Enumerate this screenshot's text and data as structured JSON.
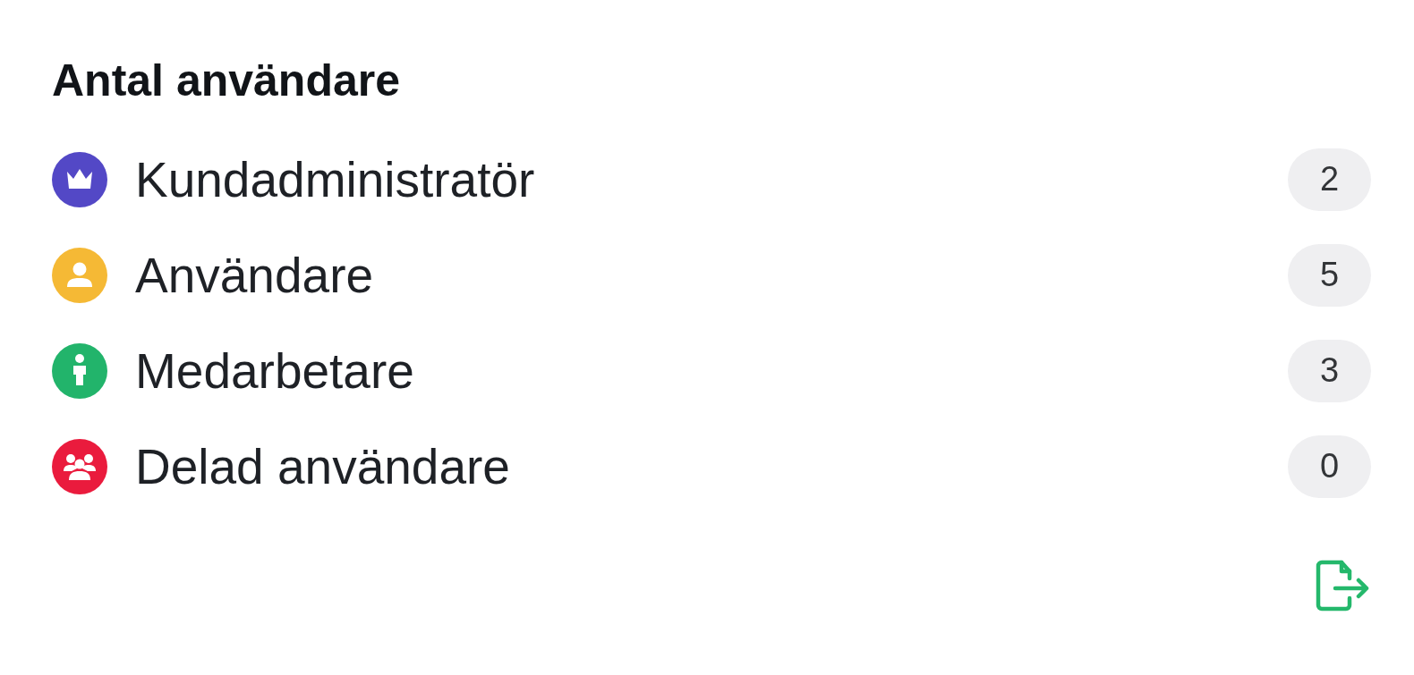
{
  "title": "Antal användare",
  "roles": [
    {
      "kind": "crown",
      "label": "Kundadministratör",
      "count": "2",
      "color": "#5348c6"
    },
    {
      "kind": "person",
      "label": "Användare",
      "count": "5",
      "color": "#f5b935"
    },
    {
      "kind": "standing",
      "label": "Medarbetare",
      "count": "3",
      "color": "#22b46b"
    },
    {
      "kind": "group",
      "label": "Delad användare",
      "count": "0",
      "color": "#ea1b3d"
    }
  ]
}
